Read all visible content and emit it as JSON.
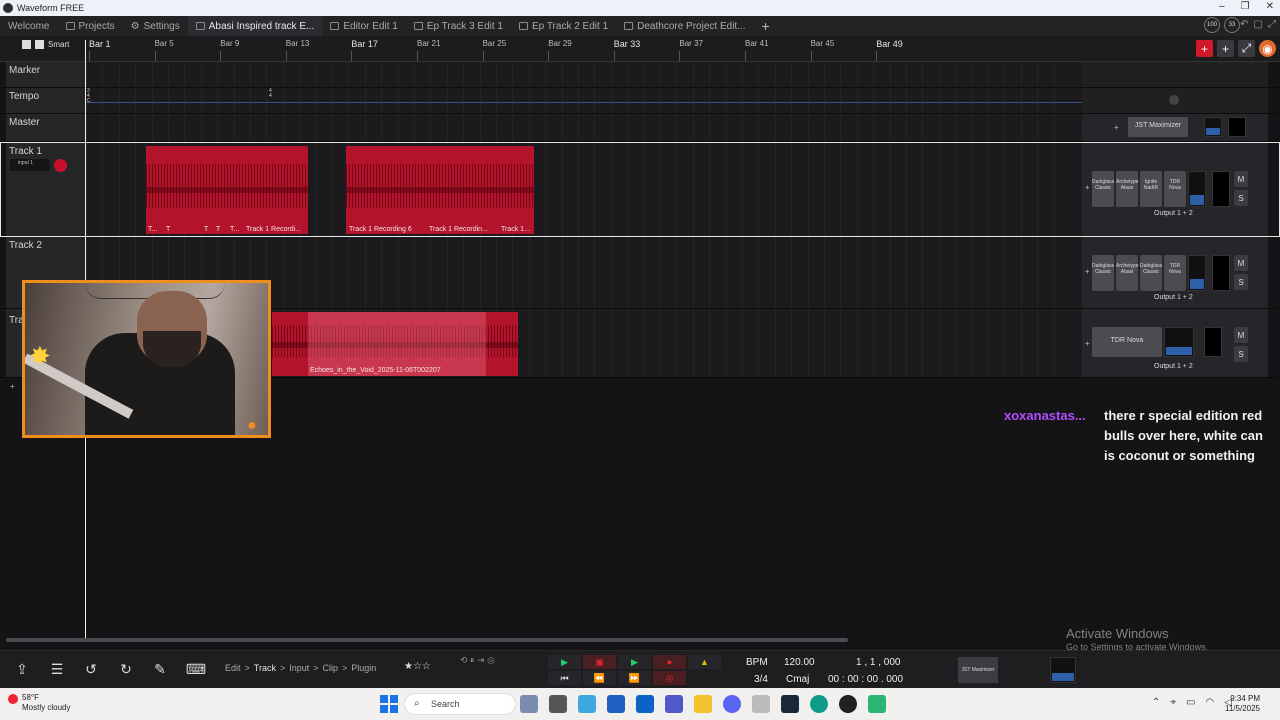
{
  "window": {
    "title": "Waveform FREE"
  },
  "tabs": [
    {
      "label": "Welcome"
    },
    {
      "label": "Projects"
    },
    {
      "label": "Settings"
    },
    {
      "label": "Abasi Inspired track E..."
    },
    {
      "label": "Editor Edit 1"
    },
    {
      "label": "Ep Track 3 Edit 1"
    },
    {
      "label": "Ep Track 2 Edit 1"
    },
    {
      "label": "Deathcore Project Edit..."
    }
  ],
  "perf": [
    "100",
    "33"
  ],
  "ruler": {
    "snap_label": "Smart",
    "bars": [
      {
        "label": "Bar 1",
        "major": true
      },
      {
        "label": "Bar 5",
        "major": false
      },
      {
        "label": "Bar 9",
        "major": false
      },
      {
        "label": "Bar 13",
        "major": false
      },
      {
        "label": "Bar 17",
        "major": true
      },
      {
        "label": "Bar 21",
        "major": false
      },
      {
        "label": "Bar 25",
        "major": false
      },
      {
        "label": "Bar 29",
        "major": false
      },
      {
        "label": "Bar 33",
        "major": true
      },
      {
        "label": "Bar 37",
        "major": false
      },
      {
        "label": "Bar 41",
        "major": false
      },
      {
        "label": "Bar 45",
        "major": false
      },
      {
        "label": "Bar 49",
        "major": true
      }
    ]
  },
  "tracks": {
    "marker": "Marker",
    "tempo": "Tempo",
    "tempo_sig_1": "3 4 C",
    "tempo_sig_2": "4 4",
    "master": "Master",
    "master_plugin": "JST Maximizer",
    "track1": {
      "name": "Track 1",
      "input": "input 1",
      "clips": [
        "T...",
        "T",
        "T",
        "T",
        "T...",
        "Track 1 Recordi...",
        "Track 1 Recording 6",
        "Track 1 Recordin...",
        "Track 1..."
      ],
      "plugins": [
        "Darkglass Classic",
        "Archetype Abasi",
        "Ignite NadIR",
        "TDR Nova"
      ],
      "output": "Output 1 + 2",
      "mute": "M",
      "solo": "S"
    },
    "track2": {
      "name": "Track 2",
      "plugins": [
        "Darkglass Classic",
        "Archetype Abasi",
        "Darkglass Classic",
        "TDR Nova"
      ],
      "output": "Output 1 + 2",
      "mute": "M",
      "solo": "S"
    },
    "track3": {
      "name": "Tra",
      "clip": "Echoes_in_the_Void_2025-11-06T002207",
      "plugin": "TDR Nova",
      "output": "Output 1 + 2",
      "mute": "M",
      "solo": "S"
    }
  },
  "chat": {
    "user": "xoxanastas...",
    "message": "there r special edition red bulls over here, white can is coconut or something",
    "user_color": "#b14cff"
  },
  "activate": {
    "title": "Activate Windows",
    "subtitle": "Go to Settings to activate Windows."
  },
  "toolbar": {
    "breadcrumbs": [
      "Edit",
      ">",
      "Track",
      ">",
      "Input",
      ">",
      "Clip",
      ">",
      "Plugin"
    ],
    "bpm_label": "BPM",
    "bpm": "120.00",
    "position": "1 , 1 , 000",
    "time_sig": "3/4",
    "key": "Cmaj",
    "time": "00 : 00 : 00 . 000",
    "mini_plugin": "JST Maximizer"
  },
  "taskbar": {
    "temp": "58°F",
    "weather": "Mostly cloudy",
    "search": "Search",
    "time": "9:34 PM",
    "date": "11/5/2025"
  },
  "colors": {
    "clip": "#b3142c",
    "webcam_border": "#f08d1f",
    "record": "#e23",
    "play": "#25d06b"
  }
}
